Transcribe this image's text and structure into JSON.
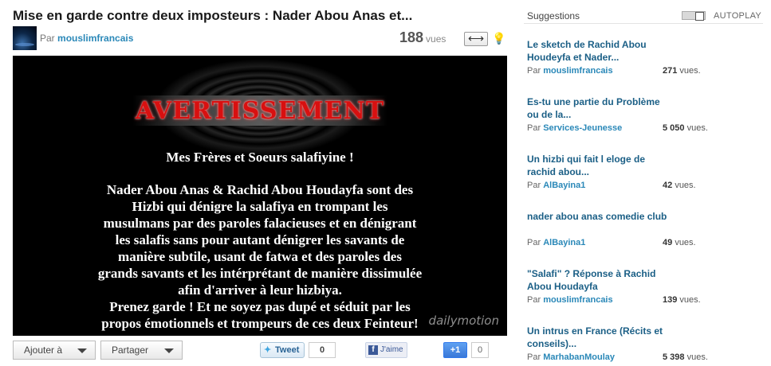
{
  "video": {
    "title": "Mise en garde contre deux imposteurs : Nader Abou Anas et...",
    "by_prefix": "Par",
    "author": "mouslimfrancais",
    "views_count": "188",
    "views_label": "vues",
    "expand_icon": "⟷",
    "bulb_icon": "💡"
  },
  "player": {
    "warning": "AVERTISSEMENT",
    "greeting": "Mes Frères et Soeurs salafiyine !",
    "message_lines": [
      "Nader Abou Anas & Rachid Abou Houdayfa sont des",
      "Hizbi qui dénigre la salafiya en trompant les",
      "musulmans par des paroles falacieuses et en dénigrant",
      "les salafis sans pour autant dénigrer les savants de",
      "manière subtile, usant de fatwa et des paroles des",
      "grands savants et les intérprétant de manière dissimulée",
      "afin d'arriver à leur hizbiya.",
      "Prenez garde ! Et ne soyez pas dupé et séduit par les",
      "propos émotionnels et trompeurs de ces deux Feinteur!"
    ],
    "watermark": "dailymotion"
  },
  "actions": {
    "add_label": "Ajouter à",
    "share_label": "Partager",
    "tweet_label": "Tweet",
    "tweet_count": "0",
    "like_label": "J'aime",
    "plusone_label": "+1",
    "plusone_count": "0"
  },
  "sidebar": {
    "title": "Suggestions",
    "autoplay_label": "AUTOPLAY",
    "items": [
      {
        "title": "Le sketch de Rachid Abou Houdeyfa et Nader...",
        "by": "Par",
        "user": "mouslimfrancais",
        "views": "271",
        "views_label": "vues."
      },
      {
        "title": "Es-tu une partie du Problème ou de la...",
        "by": "Par",
        "user": "Services-Jeunesse",
        "views": "5 050",
        "views_label": "vues."
      },
      {
        "title": "Un hizbi qui fait l eloge de rachid abou...",
        "by": "Par",
        "user": "AlBayina1",
        "views": "42",
        "views_label": "vues."
      },
      {
        "title": "nader abou anas comedie club",
        "by": "Par",
        "user": "AlBayina1",
        "views": "49",
        "views_label": "vues."
      },
      {
        "title": "\"Salafi\" ? Réponse à Rachid Abou Houdayfa",
        "by": "Par",
        "user": "mouslimfrancais",
        "views": "139",
        "views_label": "vues."
      },
      {
        "title": "Un intrus en France (Récits et conseils)...",
        "by": "Par",
        "user": "MarhabanMoulay",
        "views": "5 398",
        "views_label": "vues."
      }
    ]
  }
}
